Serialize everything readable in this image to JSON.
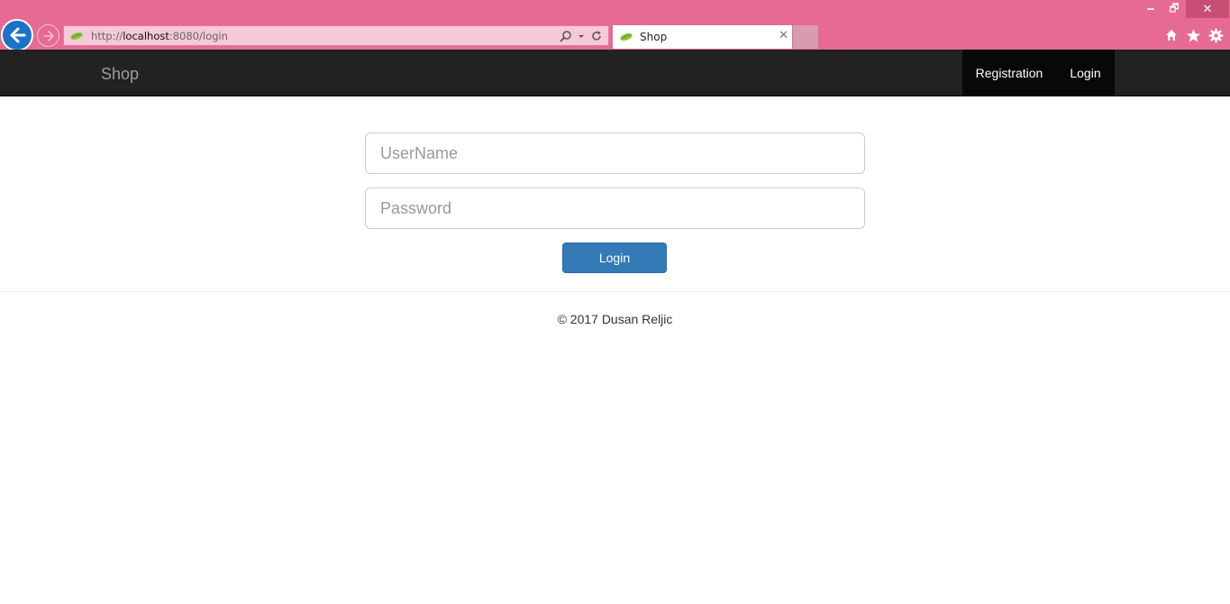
{
  "browser": {
    "url_prefix": "http://",
    "url_host": "localhost",
    "url_rest": ":8080/login",
    "tab_title": "Shop",
    "window_controls": {
      "minimize": "🗕",
      "maximize": "🗗",
      "close": "✕"
    },
    "tab_close": "✕",
    "icons": [
      "back-arrow-icon",
      "forward-arrow-icon",
      "search-icon",
      "dropdown-icon",
      "refresh-icon",
      "home-icon",
      "star-icon",
      "gear-icon"
    ]
  },
  "navbar": {
    "brand": "Shop",
    "links": [
      {
        "label": "Registration"
      },
      {
        "label": "Login"
      }
    ]
  },
  "form": {
    "username_placeholder": "UserName",
    "password_placeholder": "Password",
    "submit_label": "Login"
  },
  "footer": {
    "text": "© 2017 Dusan Reljic"
  },
  "colors": {
    "chrome": "#e66a93",
    "navbar": "#222222",
    "nav_active": "#080808",
    "primary_button": "#337ab7"
  }
}
